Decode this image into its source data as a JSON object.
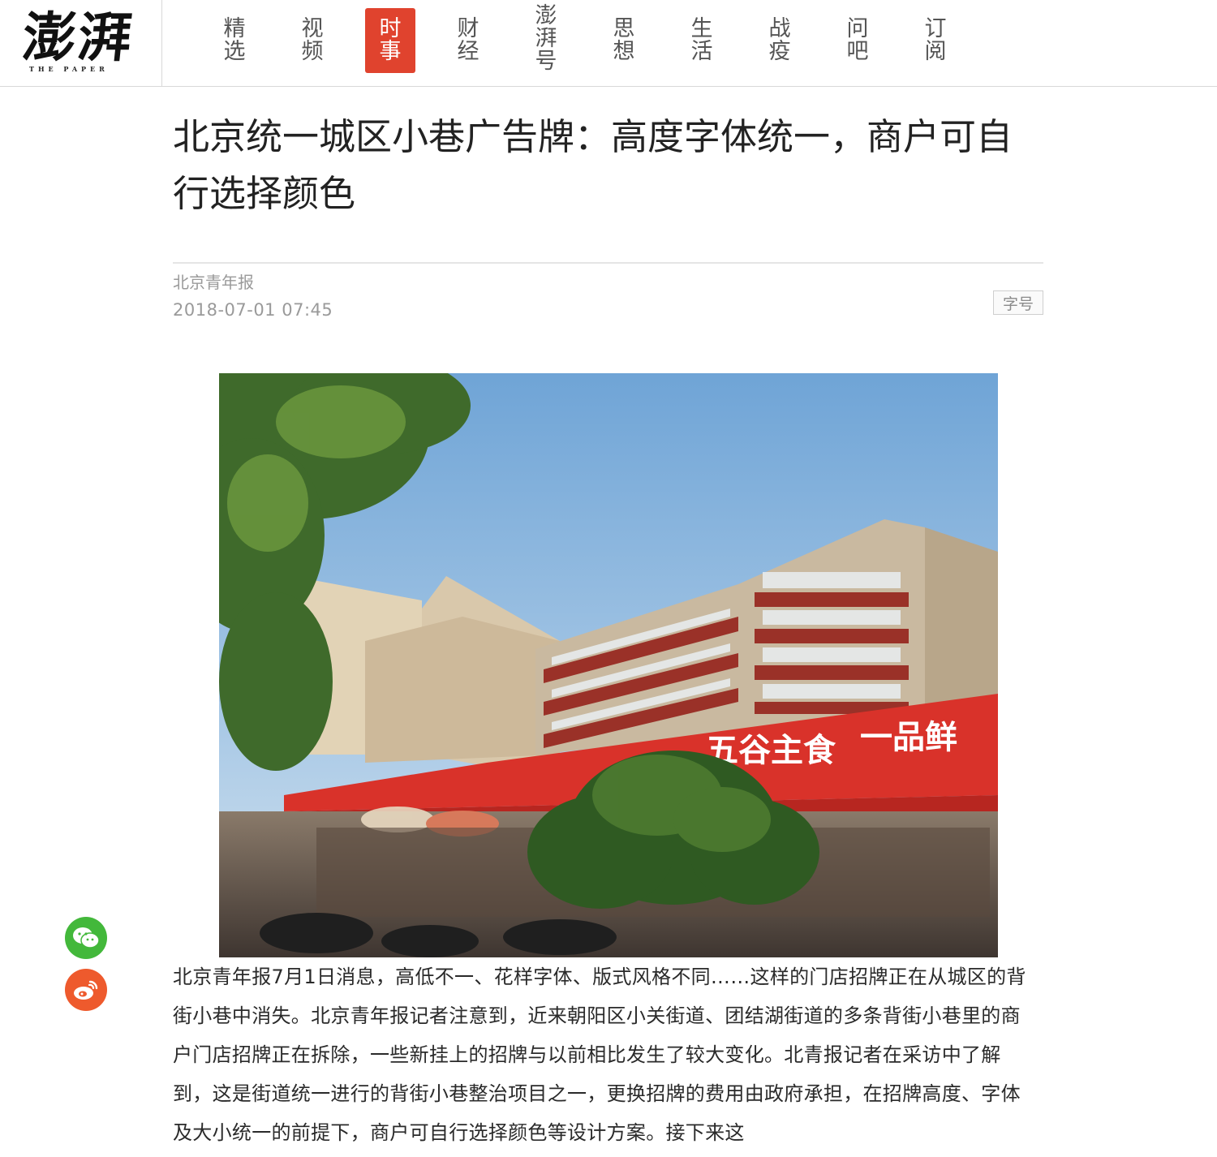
{
  "site": {
    "logo_text": "澎湃",
    "logo_sub": "THE PAPER"
  },
  "nav": {
    "items": [
      {
        "label": "精选",
        "active": false
      },
      {
        "label": "视频",
        "active": false
      },
      {
        "label": "时事",
        "active": true
      },
      {
        "label": "财经",
        "active": false
      },
      {
        "label": "澎湃号",
        "active": false
      },
      {
        "label": "思想",
        "active": false
      },
      {
        "label": "生活",
        "active": false
      },
      {
        "label": "战疫",
        "active": false
      },
      {
        "label": "问吧",
        "active": false
      },
      {
        "label": "订阅",
        "active": false
      }
    ],
    "active_color": "#e0432e"
  },
  "article": {
    "title": "北京统一城区小巷广告牌：高度字体统一，商户可自行选择颜色",
    "source": "北京青年报",
    "date": "2018-07-01 07:45",
    "font_size_button": "字号",
    "photo_signs": {
      "sign1": "五谷主食",
      "sign2": "一品鲜"
    },
    "body": "北京青年报7月1日消息，高低不一、花样字体、版式风格不同……这样的门店招牌正在从城区的背街小巷中消失。北京青年报记者注意到，近来朝阳区小关街道、团结湖街道的多条背街小巷里的商户门店招牌正在拆除，一些新挂上的招牌与以前相比发生了较大变化。北青报记者在采访中了解到，这是街道统一进行的背街小巷整治项目之一，更换招牌的费用由政府承担，在招牌高度、字体及大小统一的前提下，商户可自行选择颜色等设计方案。接下来这"
  },
  "share": {
    "wechat_icon": "wechat-icon",
    "weibo_icon": "weibo-icon",
    "wechat_color": "#43b83b",
    "weibo_color": "#ee5a2d"
  }
}
